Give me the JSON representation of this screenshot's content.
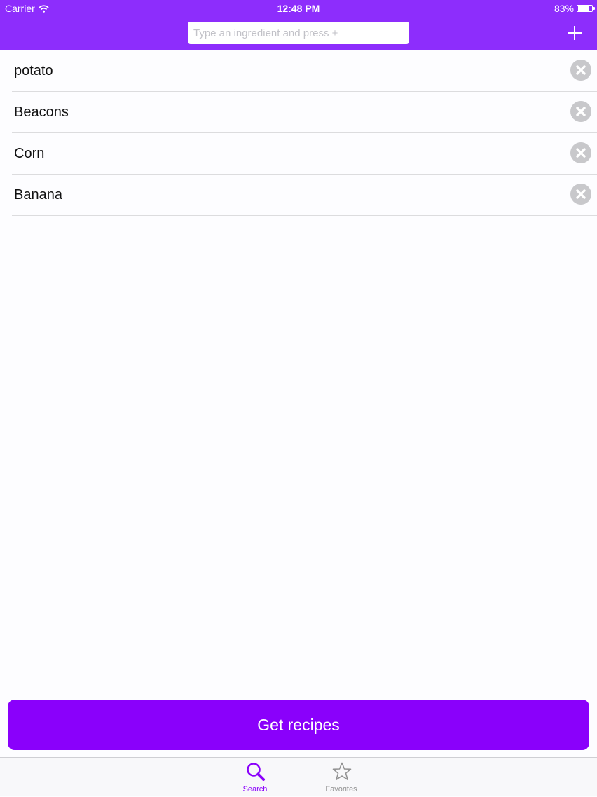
{
  "status_bar": {
    "carrier": "Carrier",
    "time": "12:48 PM",
    "battery": "83%",
    "battery_level": 0.83
  },
  "header": {
    "search_placeholder": "Type an ingredient and press +",
    "search_value": "",
    "add_icon": "plus-icon",
    "color": "#8d2dfc"
  },
  "ingredients": [
    {
      "name": "potato",
      "remove_icon": "clear-icon"
    },
    {
      "name": "Beacons",
      "remove_icon": "clear-icon"
    },
    {
      "name": "Corn",
      "remove_icon": "clear-icon"
    },
    {
      "name": "Banana",
      "remove_icon": "clear-icon"
    }
  ],
  "get_recipes_label": "Get recipes",
  "button_color": "#8a00fb",
  "tab_bar": {
    "tabs": [
      {
        "label": "Search",
        "icon": "search-icon",
        "selected": true
      },
      {
        "label": "Favorites",
        "icon": "star-icon",
        "selected": false
      }
    ],
    "active_color": "#8a00fb",
    "inactive_color": "#929292"
  }
}
